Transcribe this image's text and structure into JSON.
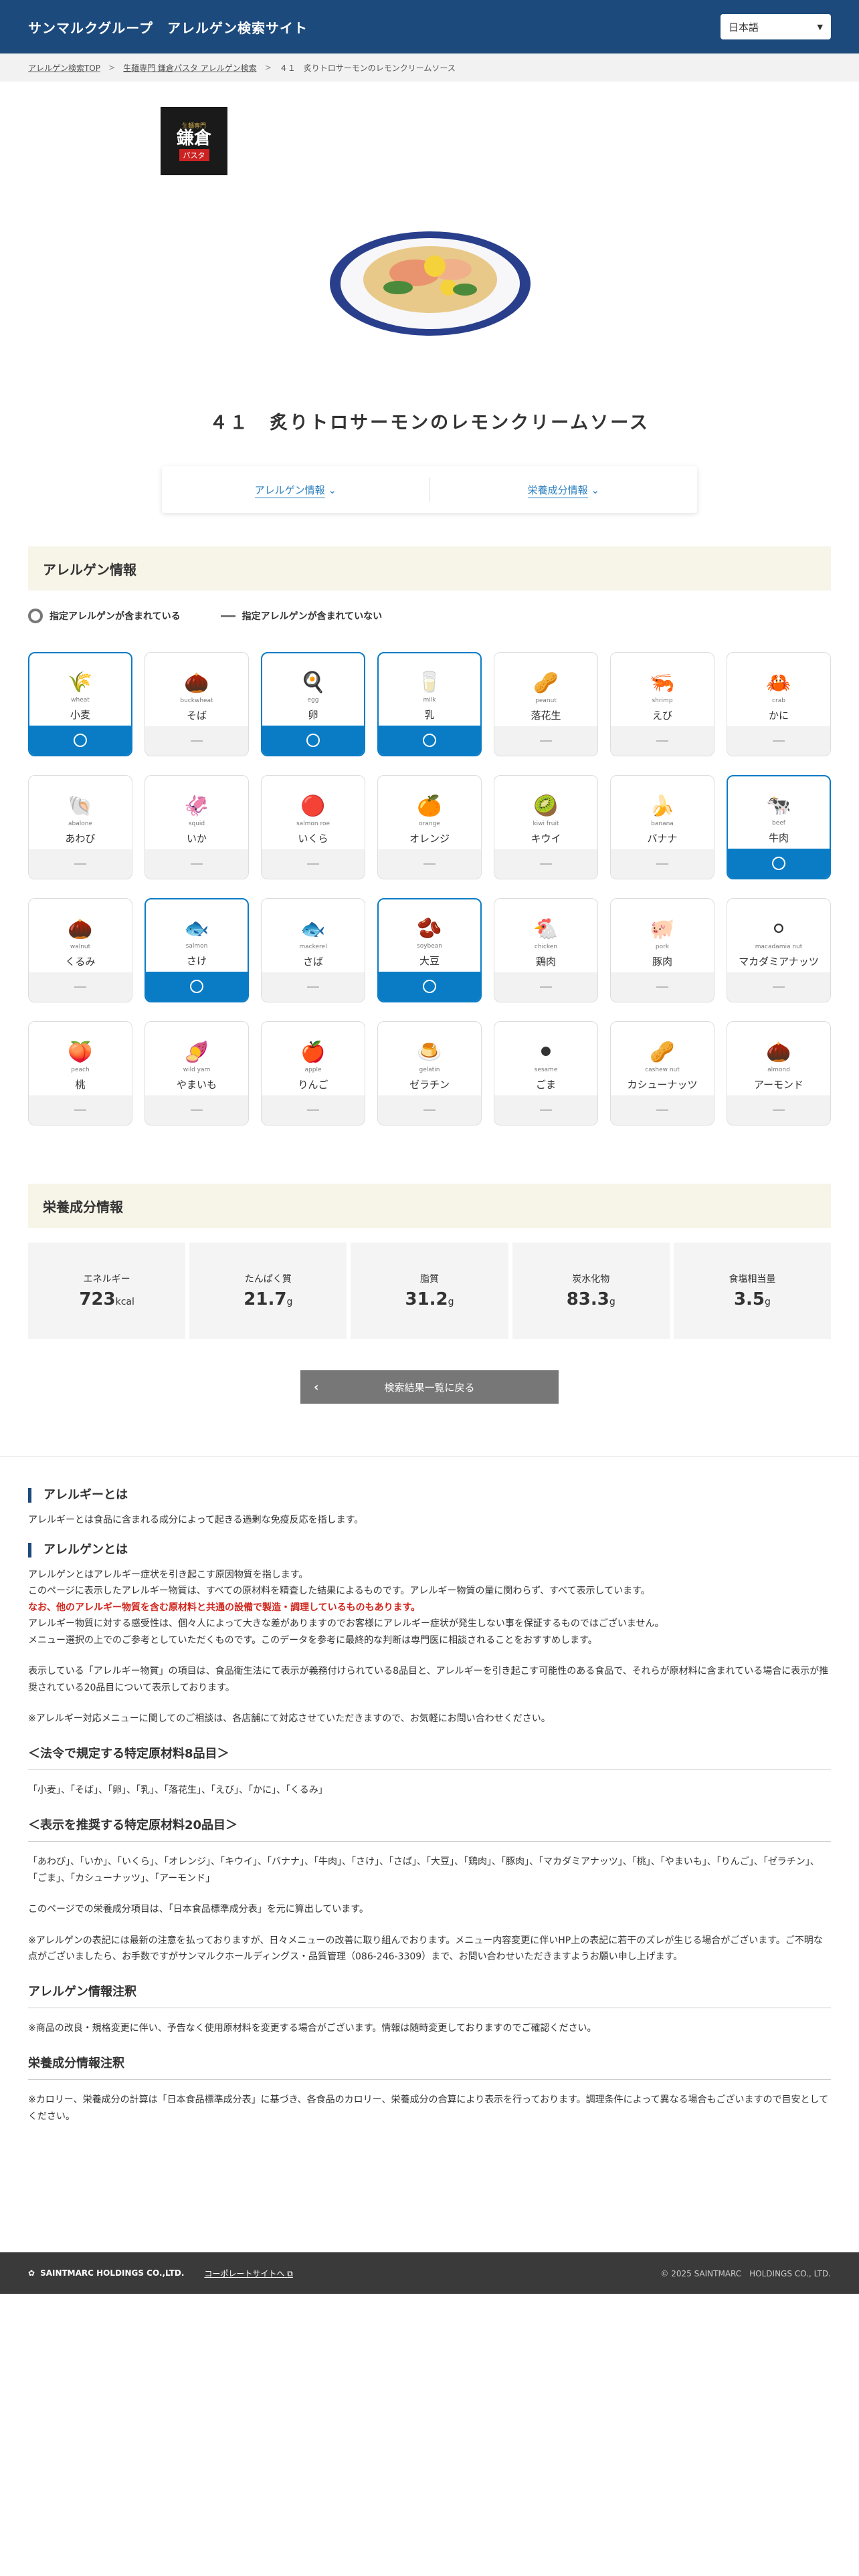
{
  "header": {
    "title": "サンマルクグループ　アレルゲン検索サイト",
    "lang": "日本語"
  },
  "breadcrumb": [
    "アレルゲン検索TOP",
    "生麺専門 鎌倉パスタ アレルゲン検索",
    "４１　炙りトロサーモンのレモンクリームソース"
  ],
  "logo": {
    "top": "生麺専門",
    "main": "鎌倉",
    "sub": "パスタ"
  },
  "dish_title": "４１　炙りトロサーモンのレモンクリームソース",
  "tabs": [
    "アレルゲン情報",
    "栄養成分情報"
  ],
  "allergen_section": {
    "title": "アレルゲン情報",
    "legend_contains": "指定アレルゲンが含まれている",
    "legend_not": "指定アレルゲンが含まれていない"
  },
  "allergens": [
    {
      "en": "wheat",
      "jp": "小麦",
      "on": true,
      "icon": "wheat-icon",
      "glyph": "🌾"
    },
    {
      "en": "buckwheat",
      "jp": "そば",
      "on": false,
      "icon": "buckwheat-icon",
      "glyph": "🌰"
    },
    {
      "en": "egg",
      "jp": "卵",
      "on": true,
      "icon": "egg-icon",
      "glyph": "🍳"
    },
    {
      "en": "milk",
      "jp": "乳",
      "on": true,
      "icon": "milk-icon",
      "glyph": "🥛"
    },
    {
      "en": "peanut",
      "jp": "落花生",
      "on": false,
      "icon": "peanut-icon",
      "glyph": "🥜"
    },
    {
      "en": "shrimp",
      "jp": "えび",
      "on": false,
      "icon": "shrimp-icon",
      "glyph": "🦐"
    },
    {
      "en": "crab",
      "jp": "かに",
      "on": false,
      "icon": "crab-icon",
      "glyph": "🦀"
    },
    {
      "en": "abalone",
      "jp": "あわび",
      "on": false,
      "icon": "abalone-icon",
      "glyph": "🐚"
    },
    {
      "en": "squid",
      "jp": "いか",
      "on": false,
      "icon": "squid-icon",
      "glyph": "🦑"
    },
    {
      "en": "salmon roe",
      "jp": "いくら",
      "on": false,
      "icon": "salmon-roe-icon",
      "glyph": "🔴"
    },
    {
      "en": "orange",
      "jp": "オレンジ",
      "on": false,
      "icon": "orange-icon",
      "glyph": "🍊"
    },
    {
      "en": "kiwi fruit",
      "jp": "キウイ",
      "on": false,
      "icon": "kiwi-icon",
      "glyph": "🥝"
    },
    {
      "en": "banana",
      "jp": "バナナ",
      "on": false,
      "icon": "banana-icon",
      "glyph": "🍌"
    },
    {
      "en": "beef",
      "jp": "牛肉",
      "on": true,
      "icon": "beef-icon",
      "glyph": "🐄"
    },
    {
      "en": "walnut",
      "jp": "くるみ",
      "on": false,
      "icon": "walnut-icon",
      "glyph": "🌰"
    },
    {
      "en": "salmon",
      "jp": "さけ",
      "on": true,
      "icon": "salmon-icon",
      "glyph": "🐟"
    },
    {
      "en": "mackerel",
      "jp": "さば",
      "on": false,
      "icon": "mackerel-icon",
      "glyph": "🐟"
    },
    {
      "en": "soybean",
      "jp": "大豆",
      "on": true,
      "icon": "soybean-icon",
      "glyph": "🫘"
    },
    {
      "en": "chicken",
      "jp": "鶏肉",
      "on": false,
      "icon": "chicken-icon",
      "glyph": "🐔"
    },
    {
      "en": "pork",
      "jp": "豚肉",
      "on": false,
      "icon": "pork-icon",
      "glyph": "🐖"
    },
    {
      "en": "macadamia nut",
      "jp": "マカダミアナッツ",
      "on": false,
      "icon": "macadamia-icon",
      "glyph": "⚪"
    },
    {
      "en": "peach",
      "jp": "桃",
      "on": false,
      "icon": "peach-icon",
      "glyph": "🍑"
    },
    {
      "en": "wild yam",
      "jp": "やまいも",
      "on": false,
      "icon": "yam-icon",
      "glyph": "🍠"
    },
    {
      "en": "apple",
      "jp": "りんご",
      "on": false,
      "icon": "apple-icon",
      "glyph": "🍎"
    },
    {
      "en": "gelatin",
      "jp": "ゼラチン",
      "on": false,
      "icon": "gelatin-icon",
      "glyph": "🍮"
    },
    {
      "en": "sesame",
      "jp": "ごま",
      "on": false,
      "icon": "sesame-icon",
      "glyph": "⚫"
    },
    {
      "en": "cashew nut",
      "jp": "カシューナッツ",
      "on": false,
      "icon": "cashew-icon",
      "glyph": "🥜"
    },
    {
      "en": "almond",
      "jp": "アーモンド",
      "on": false,
      "icon": "almond-icon",
      "glyph": "🌰"
    }
  ],
  "nutrition_section": {
    "title": "栄養成分情報"
  },
  "nutrition": [
    {
      "label": "エネルギー",
      "value": "723",
      "unit": "kcal"
    },
    {
      "label": "たんぱく質",
      "value": "21.7",
      "unit": "g"
    },
    {
      "label": "脂質",
      "value": "31.2",
      "unit": "g"
    },
    {
      "label": "炭水化物",
      "value": "83.3",
      "unit": "g"
    },
    {
      "label": "食塩相当量",
      "value": "3.5",
      "unit": "g"
    }
  ],
  "back_button": "検索結果一覧に戻る",
  "info": {
    "allergy_title": "アレルギーとは",
    "allergy_text": "アレルギーとは食品に含まれる成分によって起きる過剰な免疫反応を指します。",
    "allergen_title": "アレルゲンとは",
    "allergen_p1": "アレルゲンとはアレルギー症状を引き起こす原因物質を指します。",
    "allergen_p2": "このページに表示したアレルギー物質は、すべての原材料を精査した結果によるものです。アレルギー物質の量に関わらず、すべて表示しています。",
    "allergen_red": "なお、他のアレルギー物質を含む原材料と共通の設備で製造・調理しているものもあります。",
    "allergen_p3": "アレルギー物質に対する感受性は、個々人によって大きな差がありますのでお客様にアレルギー症状が発生しない事を保証するものではございません。",
    "allergen_p4": "メニュー選択の上でのご参考としていただくものです。このデータを参考に最終的な判断は専門医に相談されることをおすすめします。",
    "allergen_p5": "表示している「アレルギー物質」の項目は、食品衛生法にて表示が義務付けられている8品目と、アレルギーを引き起こす可能性のある食品で、それらが原材料に含まれている場合に表示が推奨されている20品目について表示しております。",
    "allergen_p6": "※アレルギー対応メニューに関してのご相談は、各店舗にて対応させていただきますので、お気軽にお問い合わせください。",
    "law8_title": "＜法令で規定する特定原材料8品目＞",
    "law8_text": "「小麦」、「そば」、「卵」、「乳」、「落花生」、「えび」、「かに」、「くるみ」",
    "rec20_title": "＜表示を推奨する特定原材料20品目＞",
    "rec20_text": "「あわび」、「いか」、「いくら」、「オレンジ」、「キウイ」、「バナナ」、「牛肉」、「さけ」、「さば」、「大豆」、「鶏肉」、「豚肉」、「マカダミアナッツ」、「桃」、「やまいも」、「りんご」、「ゼラチン」、「ごま」、「カシューナッツ」、「アーモンド」",
    "nut_note": "このページでの栄養成分項目は、「日本食品標準成分表」を元に算出しています。",
    "update_note": "※アレルゲンの表記には最新の注意を払っておりますが、日々メニューの改善に取り組んでおります。メニュー内容変更に伴いHP上の表記に若干のズレが生じる場合がございます。ご不明な点がございましたら、お手数ですがサンマルクホールディングス・品質管理（086-246-3309）まで、お問い合わせいただきますようお願い申し上げます。",
    "allergen_note_title": "アレルゲン情報注釈",
    "allergen_note": "※商品の改良・規格変更に伴い、予告なく使用原材料を変更する場合がございます。情報は随時変更しておりますのでご確認ください。",
    "nut_note_title": "栄養成分情報注釈",
    "nut_note2": "※カロリー、栄養成分の計算は「日本食品標準成分表」に基づき、各食品のカロリー、栄養成分の合算により表示を行っております。調理条件によって異なる場合もございますので目安としてください。"
  },
  "footer": {
    "brand": "SAINTMARC HOLDINGS CO.,LTD.",
    "corp_link": "コーポレートサイトへ",
    "copyright": "© 2025 SAINTMARC　HOLDINGS CO., LTD."
  }
}
